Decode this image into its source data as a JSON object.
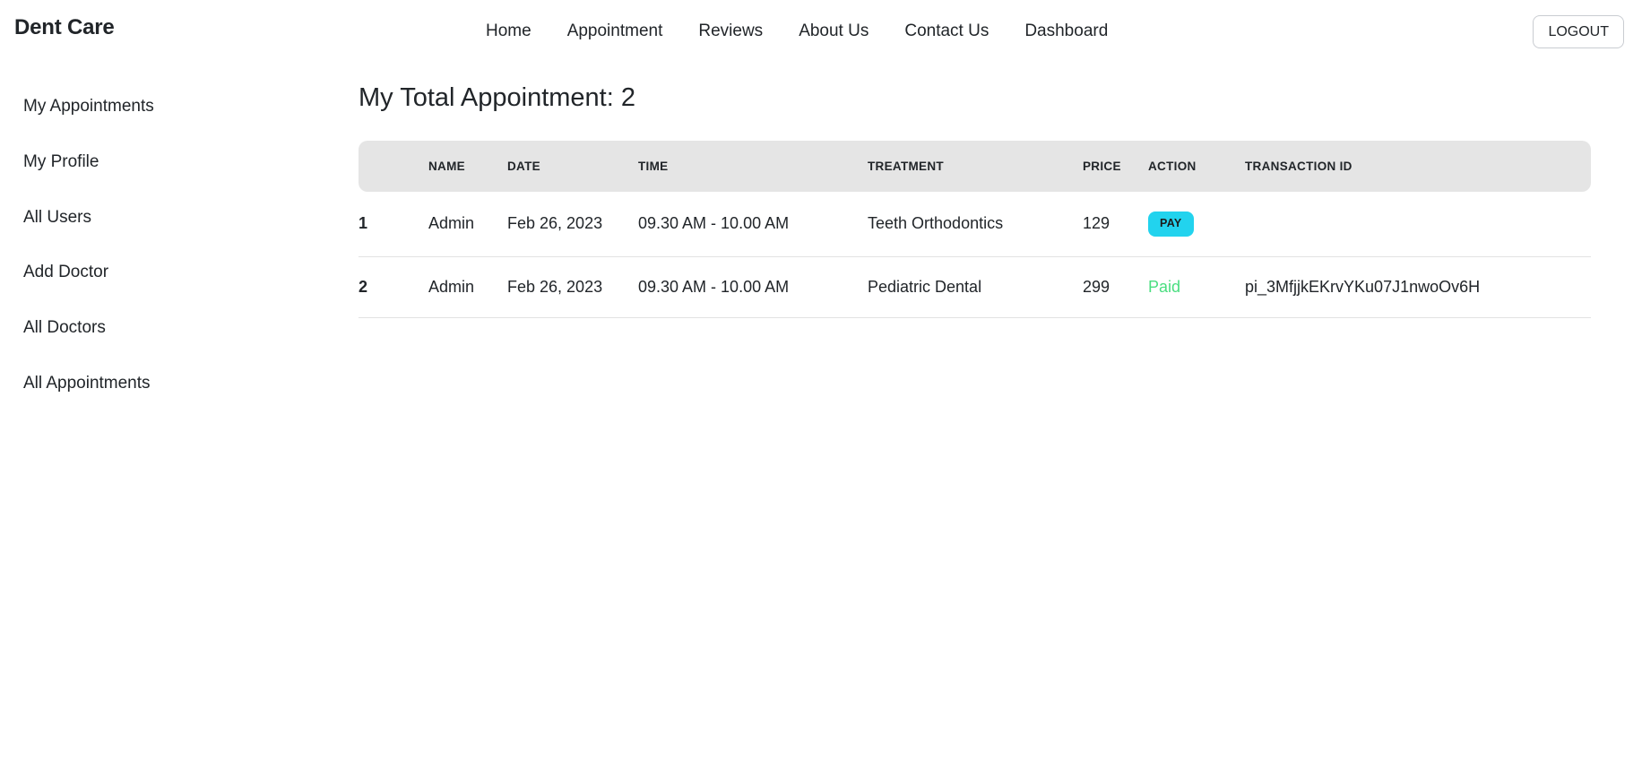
{
  "navbar": {
    "brand": "Dent Care",
    "links": [
      {
        "label": "Home"
      },
      {
        "label": "Appointment"
      },
      {
        "label": "Reviews"
      },
      {
        "label": "About Us"
      },
      {
        "label": "Contact Us"
      },
      {
        "label": "Dashboard"
      }
    ],
    "logout_label": "LOGOUT"
  },
  "sidebar": {
    "items": [
      {
        "label": "My Appointments"
      },
      {
        "label": "My Profile"
      },
      {
        "label": "All Users"
      },
      {
        "label": "Add Doctor"
      },
      {
        "label": "All Doctors"
      },
      {
        "label": "All Appointments"
      }
    ]
  },
  "main": {
    "page_title": "My Total Appointment: 2",
    "table": {
      "headers": {
        "index": "",
        "name": "NAME",
        "date": "DATE",
        "time": "TIME",
        "treatment": "TREATMENT",
        "price": "PRICE",
        "action": "ACTION",
        "transaction_id": "TRANSACTION ID"
      },
      "rows": [
        {
          "index": "1",
          "name": "Admin",
          "date": "Feb 26, 2023",
          "time": "09.30 AM - 10.00 AM",
          "treatment": "Teeth Orthodontics",
          "price": "129",
          "action_type": "pay",
          "action_label": "PAY",
          "transaction_id": ""
        },
        {
          "index": "2",
          "name": "Admin",
          "date": "Feb 26, 2023",
          "time": "09.30 AM - 10.00 AM",
          "treatment": "Pediatric Dental",
          "price": "299",
          "action_type": "paid",
          "action_label": "Paid",
          "transaction_id": "pi_3MfjjkEKrvYKu07J1nwoOv6H"
        }
      ]
    }
  },
  "colors": {
    "pay_button_bg": "#22d3ee",
    "paid_text": "#4ade80",
    "table_header_bg": "#e5e5e5",
    "text": "#212529"
  }
}
